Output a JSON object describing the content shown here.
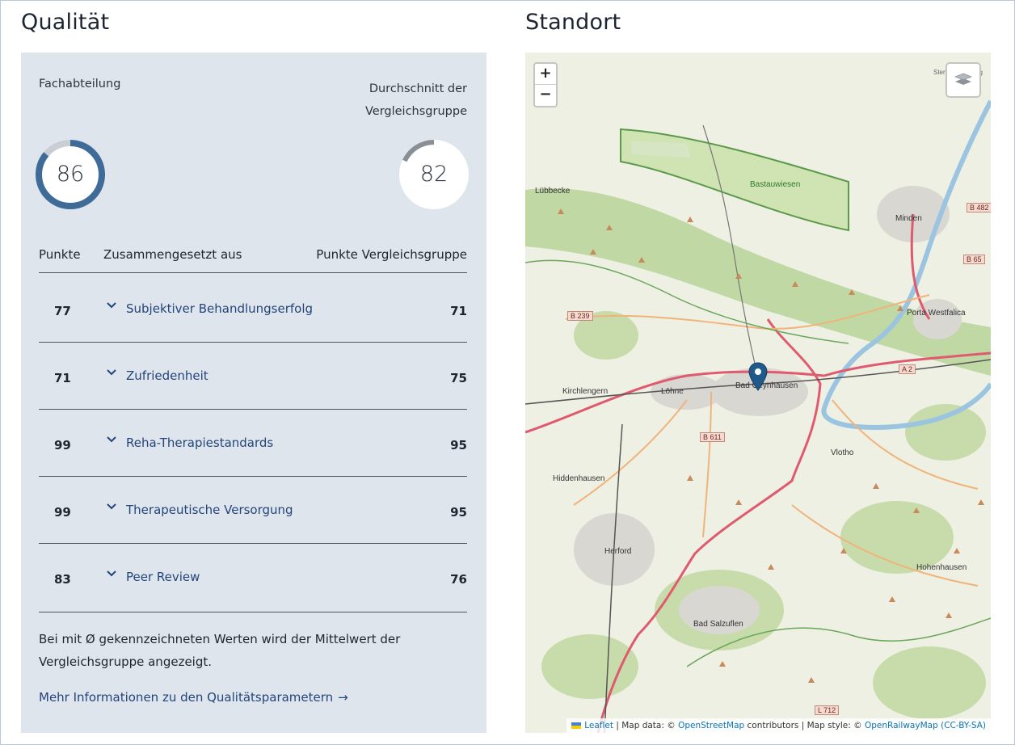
{
  "quality": {
    "title": "Qualität",
    "department_label": "Fachabteilung",
    "group_label_line1": "Durchschnitt der",
    "group_label_line2": "Vergleichsgruppe",
    "department_score": 86,
    "group_score": 82,
    "department_score_text": "86",
    "group_score_text": "82",
    "columns": {
      "points": "Punkte",
      "composed": "Zusammengesetzt aus",
      "group_points": "Punkte Vergleichsgruppe"
    },
    "rows": [
      {
        "points": "77",
        "name": "Subjektiver Behandlungserfolg",
        "group": "71"
      },
      {
        "points": "71",
        "name": "Zufriedenheit",
        "group": "75"
      },
      {
        "points": "99",
        "name": "Reha-Therapiestandards",
        "group": "95"
      },
      {
        "points": "99",
        "name": "Therapeutische Versorgung",
        "group": "95"
      },
      {
        "points": "83",
        "name": "Peer Review",
        "group": "76"
      }
    ],
    "note": "Bei mit Ø gekennzeichneten Werten wird der Mittelwert der Vergleichsgruppe angezeigt.",
    "more_link": "Mehr Informationen zu den Qualitätsparametern",
    "more_arrow": "→"
  },
  "location": {
    "title": "Standort",
    "zoom_in": "+",
    "zoom_out": "−",
    "attribution": {
      "leaflet": "Leaflet",
      "sep1": " | Map data: © ",
      "osm": "OpenStreetMap",
      "mid": " contributors | Map style: © ",
      "orm": "OpenRailwayMap",
      "cc": "(CC-BY-SA)"
    },
    "places": {
      "luebbecke": "Lübbecke",
      "minden": "Minden",
      "bastauwiesen": "Bastauwiesen",
      "porta": "Porta Westfalica",
      "kirchlengern": "Kirchlengern",
      "loehne": "Löhne",
      "badoeyn": "Bad Oeynhausen",
      "vlotho": "Vlotho",
      "hiddenhausen": "Hiddenhausen",
      "herford": "Herford",
      "hohenhausen": "Hohenhausen",
      "badsalzuflen": "Bad Salzuflen",
      "stemmer": "Stemmer Anstieg"
    },
    "roads": {
      "b239": "B 239",
      "b611": "B 611",
      "b65": "B 65",
      "b482": "B 482",
      "a2": "A 2",
      "l712": "L 712"
    },
    "icons": [
      "zoom-in-icon",
      "zoom-out-icon",
      "layers-icon",
      "map-marker-icon",
      "ukraine-flag-icon"
    ]
  },
  "colors": {
    "ring_fill": "#3f6b98",
    "ring_track": "#c9ced4",
    "group_ring_fill": "#8a8f96",
    "link": "#23457a",
    "panel_bg": "#dfe5ec"
  }
}
